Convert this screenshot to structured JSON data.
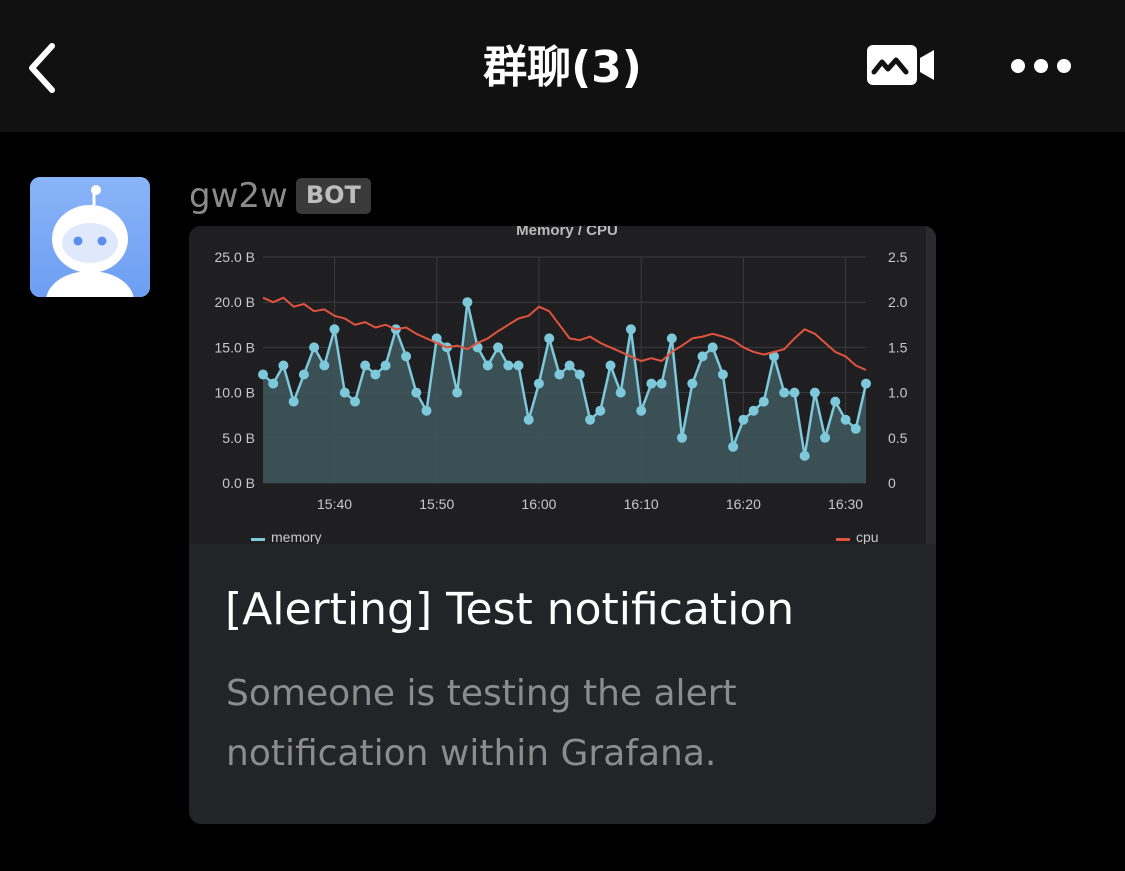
{
  "header": {
    "title": "群聊(3)",
    "back_icon": "chevron-left-icon",
    "video_icon": "video-call-icon",
    "more_icon": "more-dots-icon"
  },
  "message": {
    "sender": "gw2w",
    "badge": "BOT",
    "avatar_icon": "robot-avatar-icon",
    "card": {
      "title": "[Alerting] Test notification",
      "description": "Someone is testing the alert notification within Grafana."
    }
  },
  "colors": {
    "memory": "#7ec8dc",
    "cpu": "#e0533e",
    "card_bg": "#232427",
    "chart_bg": "#1f1f21"
  },
  "chart_data": {
    "type": "line",
    "title": "Memory / CPU",
    "x": [
      "15:33",
      "15:34",
      "15:35",
      "15:36",
      "15:37",
      "15:38",
      "15:39",
      "15:40",
      "15:41",
      "15:42",
      "15:43",
      "15:44",
      "15:45",
      "15:46",
      "15:47",
      "15:48",
      "15:49",
      "15:50",
      "15:51",
      "15:52",
      "15:53",
      "15:54",
      "15:55",
      "15:56",
      "15:57",
      "15:58",
      "15:59",
      "16:00",
      "16:01",
      "16:02",
      "16:03",
      "16:04",
      "16:05",
      "16:06",
      "16:07",
      "16:08",
      "16:09",
      "16:10",
      "16:11",
      "16:12",
      "16:13",
      "16:14",
      "16:15",
      "16:16",
      "16:17",
      "16:18",
      "16:19",
      "16:20",
      "16:21",
      "16:22",
      "16:23",
      "16:24",
      "16:25",
      "16:26",
      "16:27",
      "16:28",
      "16:29",
      "16:30",
      "16:31",
      "16:32"
    ],
    "x_ticks": [
      "15:40",
      "15:50",
      "16:00",
      "16:10",
      "16:20",
      "16:30"
    ],
    "y_ticks_left": [
      "0.0 B",
      "5.0 B",
      "10.0 B",
      "15.0 B",
      "20.0 B",
      "25.0 B"
    ],
    "y_ticks_right": [
      "0",
      "0.5",
      "1.0",
      "1.5",
      "2.0",
      "2.5"
    ],
    "ylim_left": [
      0,
      25
    ],
    "ylim_right": [
      0,
      2.5
    ],
    "series": [
      {
        "name": "memory",
        "axis": "left",
        "values": [
          12,
          11,
          13,
          9,
          12,
          15,
          13,
          17,
          10,
          9,
          13,
          12,
          13,
          17,
          14,
          10,
          8,
          16,
          15,
          10,
          20,
          15,
          13,
          15,
          13,
          13,
          7,
          11,
          16,
          12,
          13,
          12,
          7,
          8,
          13,
          10,
          17,
          8,
          11,
          11,
          16,
          5,
          11,
          14,
          15,
          12,
          4,
          7,
          8,
          9,
          14,
          10,
          10,
          3,
          10,
          5,
          9,
          7,
          6,
          11
        ]
      },
      {
        "name": "cpu",
        "axis": "right",
        "values": [
          2.05,
          2.0,
          2.05,
          1.95,
          1.98,
          1.9,
          1.92,
          1.85,
          1.82,
          1.75,
          1.78,
          1.72,
          1.75,
          1.7,
          1.72,
          1.65,
          1.6,
          1.55,
          1.5,
          1.52,
          1.48,
          1.55,
          1.6,
          1.68,
          1.75,
          1.82,
          1.85,
          1.95,
          1.9,
          1.75,
          1.6,
          1.58,
          1.62,
          1.55,
          1.5,
          1.45,
          1.4,
          1.35,
          1.38,
          1.35,
          1.45,
          1.52,
          1.6,
          1.62,
          1.65,
          1.62,
          1.58,
          1.5,
          1.45,
          1.42,
          1.45,
          1.48,
          1.6,
          1.7,
          1.65,
          1.55,
          1.45,
          1.4,
          1.3,
          1.25
        ]
      }
    ],
    "legend": [
      "memory",
      "cpu"
    ],
    "legend_placement": "bottom",
    "grid": true
  }
}
